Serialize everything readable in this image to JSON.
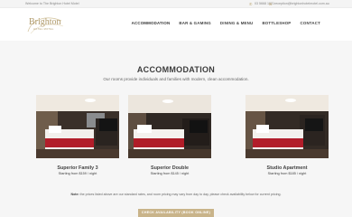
{
  "topbar": {
    "welcome": "Welcome to The Brighton Hotel Motel",
    "phone": "03 5668 1021",
    "email": "reception@brightonhotelmotel.com.au"
  },
  "logo": {
    "word": "Brighton",
    "tag": "HOTEL MOTEL"
  },
  "nav": [
    "ACCOMMODATION",
    "BAR & GAMING",
    "DINING & MENU",
    "BOTTLESHOP",
    "CONTACT"
  ],
  "section": {
    "title": "ACCOMMODATION",
    "subtitle": "Our rooms provide individuals and families with modern, clean accommodation."
  },
  "rooms": [
    {
      "name": "Superior Family 3",
      "price": "Starting from $159 / night"
    },
    {
      "name": "Superior Double",
      "price": "Starting from $145 / night"
    },
    {
      "name": "Studio Apartment",
      "price": "Starting from $185 / night"
    }
  ],
  "note": {
    "label": "Note:",
    "text": "the prices listed above are our standard rates, and room pricing may vary from day to day, please check availability below for current pricing."
  },
  "cta": "CHECK AVAILABILITY (BOOK ONLINE)",
  "colors": {
    "accent": "#c9b48a",
    "logo": "#b09a6a"
  }
}
